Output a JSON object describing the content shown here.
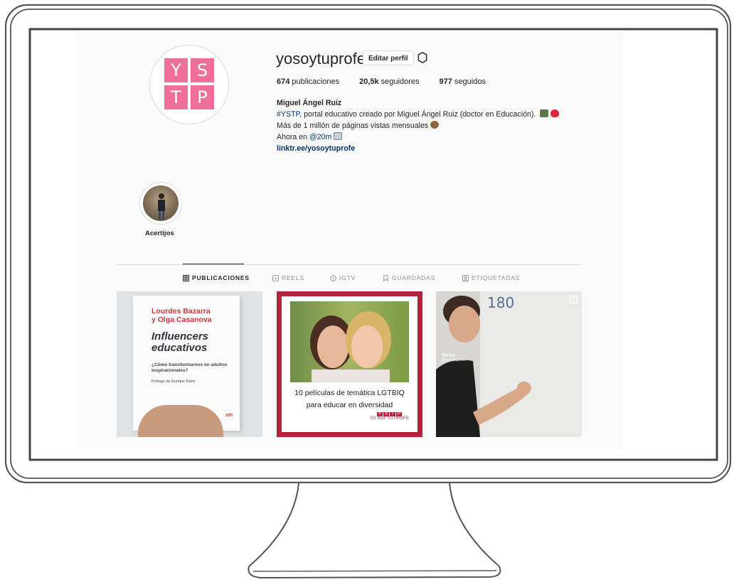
{
  "profile": {
    "username": "yosoytuprofe",
    "edit_button": "Editar perfil",
    "settings_icon": "gear-icon",
    "logo_letters": [
      "Y",
      "S",
      "T",
      "P"
    ],
    "stats": [
      {
        "value": "674",
        "label": "publicaciones"
      },
      {
        "value": "20,5k",
        "label": "seguidores"
      },
      {
        "value": "977",
        "label": "seguidos"
      }
    ],
    "bio": {
      "name": "Miguel Ángel Ruiz",
      "hashtag": "#YSTP",
      "line1_rest": ", portal educativo creado por Miguel Ángel Ruiz (doctor en Educación).",
      "line2": "Más de 1 millón de páginas vistas mensuales",
      "line3_prefix": "Ahora en ",
      "mention": "@20m",
      "website": "linktr.ee/yosoytuprofe"
    }
  },
  "highlights": [
    {
      "label": "Acertijos"
    }
  ],
  "tabs": [
    {
      "label": "PUBLICACIONES",
      "icon": "grid-icon",
      "active": true
    },
    {
      "label": "REELS",
      "icon": "reels-icon",
      "active": false
    },
    {
      "label": "IGTV",
      "icon": "igtv-icon",
      "active": false
    },
    {
      "label": "GUARDADAS",
      "icon": "bookmark-icon",
      "active": false
    },
    {
      "label": "ETIQUETADAS",
      "icon": "tagged-icon",
      "active": false
    }
  ],
  "posts": {
    "book": {
      "author_line1": "Lourdes Bazarra",
      "author_line2": "y Olga Casanova",
      "title_line1": "Influencers",
      "title_line2": "educativos",
      "subtitle": "¿Cómo transformarnos en adultos inspiracionales?",
      "prologue": "Prólogo de Enrique Dans",
      "publisher": "sm"
    },
    "movies": {
      "title_line1": "10 películas de temática LGTBIQ",
      "title_line2": "para educar en diversidad",
      "brand": "YO SOY TU PROFE"
    },
    "video": {
      "whiteboard_number": "180",
      "tiktok": "TikTok",
      "handle": "@yosoytuprofe"
    }
  },
  "colors": {
    "brand_pink": "#ee6f9a",
    "post_red": "#b91f3b",
    "link_blue": "#00376b"
  }
}
